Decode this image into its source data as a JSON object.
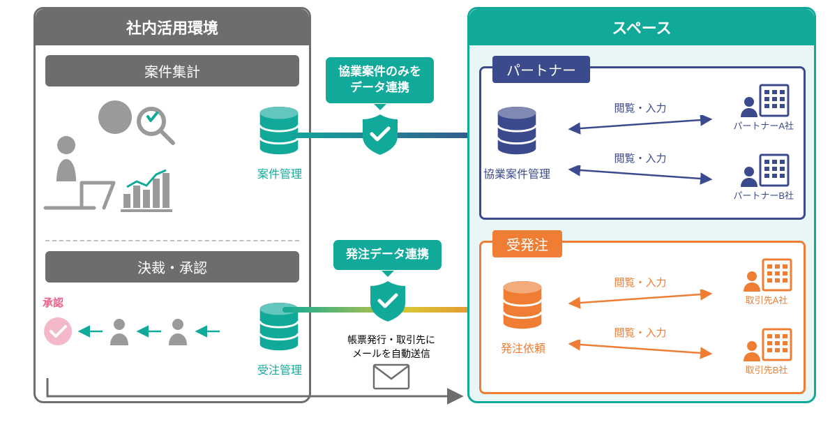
{
  "colors": {
    "teal": "#11a99a",
    "grey": "#6d6d6d",
    "navy": "#3b4a8c",
    "orange": "#ef7e34",
    "pink": "#ef5f89",
    "lightgrey": "#9a9a9a"
  },
  "left": {
    "title": "社内活用環境",
    "aggregate": {
      "header": "案件集計",
      "db_label": "案件管理"
    },
    "approval": {
      "header": "決裁・承認",
      "db_label": "受注管理",
      "approved_label": "承認"
    }
  },
  "shields": {
    "top": {
      "line1": "協業案件のみを",
      "line2": "データ連携"
    },
    "bottom": {
      "line1": "発注データ連携"
    }
  },
  "mail": {
    "line1": "帳票発行・取引先に",
    "line2": "メールを自動送信"
  },
  "right": {
    "title": "スペース",
    "partner": {
      "box_title": "パートナー",
      "db_label": "協業案件管理",
      "links": [
        {
          "label": "閲覧・入力",
          "company": "パートナーA社"
        },
        {
          "label": "閲覧・入力",
          "company": "パートナーB社"
        }
      ]
    },
    "order": {
      "box_title": "受発注",
      "db_label": "発注依頼",
      "links": [
        {
          "label": "閲覧・入力",
          "company": "取引先A社"
        },
        {
          "label": "閲覧・入力",
          "company": "取引先B社"
        }
      ]
    }
  }
}
